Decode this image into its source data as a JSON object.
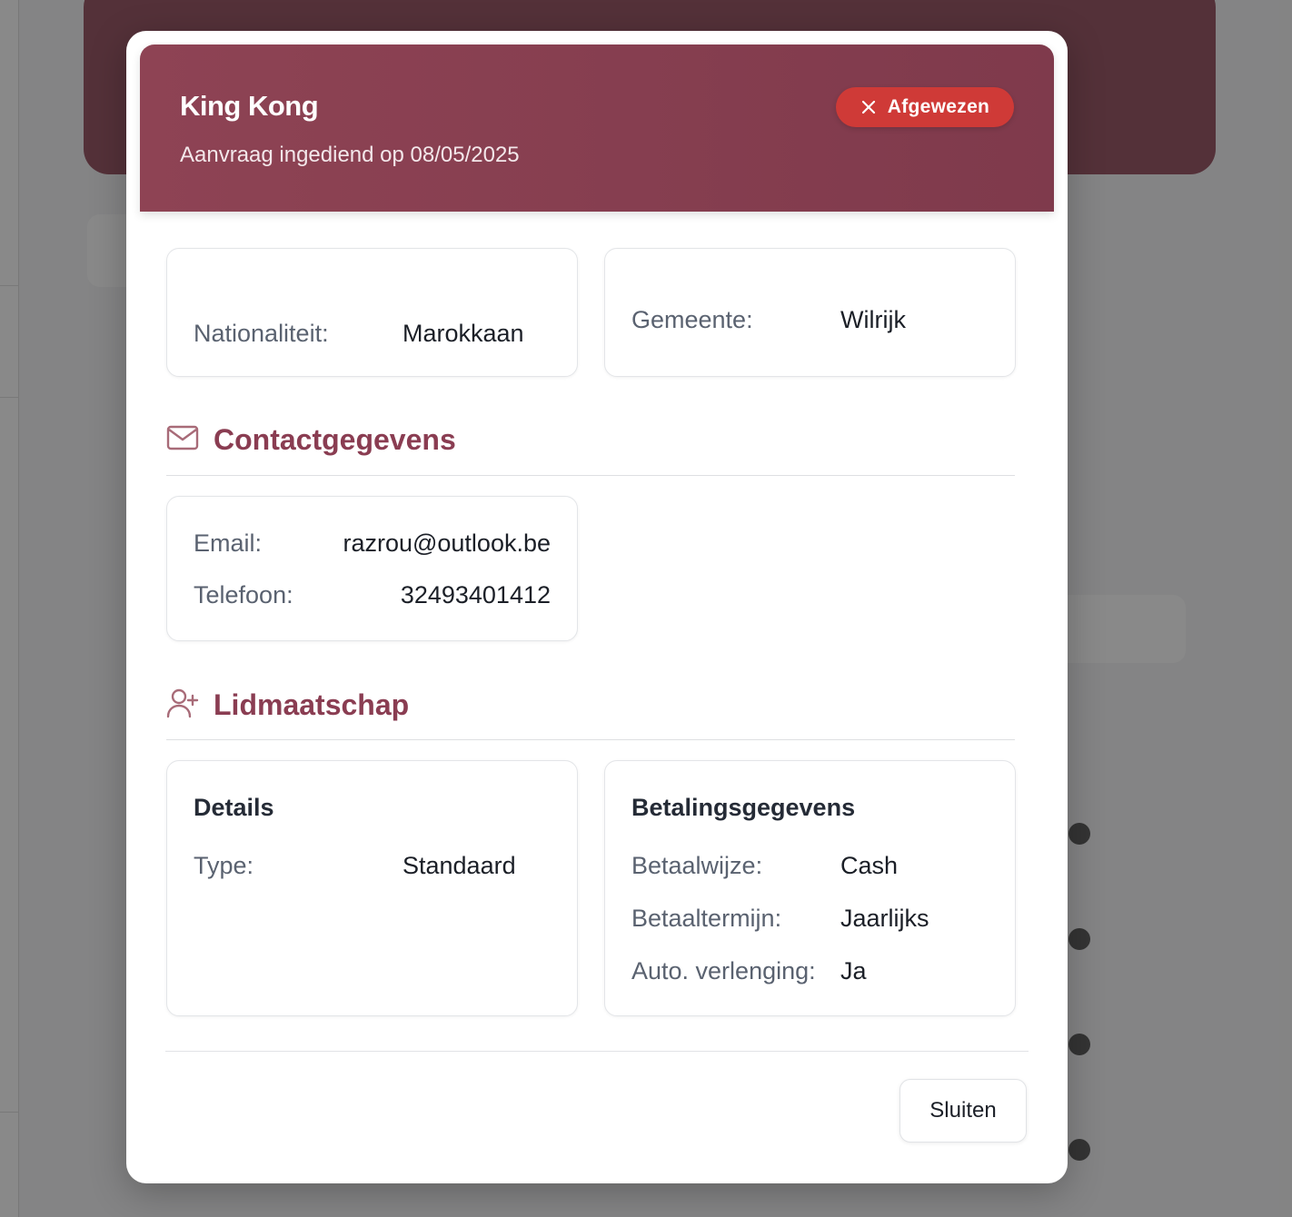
{
  "modal": {
    "title": "King Kong",
    "subtitle": "Aanvraag ingediend op 08/05/2025",
    "status": {
      "label": "Afgewezen",
      "icon": "x-icon",
      "color": "#cf3a37"
    },
    "header_color": "#8a3d52"
  },
  "personal": {
    "nationality_label": "Nationaliteit:",
    "nationality_value": "Marokkaan",
    "municipality_label": "Gemeente:",
    "municipality_value": "Wilrijk"
  },
  "contact": {
    "title": "Contactgegevens",
    "icon": "mail-icon",
    "email_label": "Email:",
    "email_value": "razrou@outlook.be",
    "phone_label": "Telefoon:",
    "phone_value": "32493401412"
  },
  "membership": {
    "title": "Lidmaatschap",
    "icon": "user-plus-icon",
    "details": {
      "title": "Details",
      "type_label": "Type:",
      "type_value": "Standaard"
    },
    "payment": {
      "title": "Betalingsgegevens",
      "method_label": "Betaalwijze:",
      "method_value": "Cash",
      "term_label": "Betaaltermijn:",
      "term_value": "Jaarlijks",
      "renewal_label": "Auto. verlenging:",
      "renewal_value": "Ja"
    }
  },
  "footer": {
    "close_label": "Sluiten"
  }
}
